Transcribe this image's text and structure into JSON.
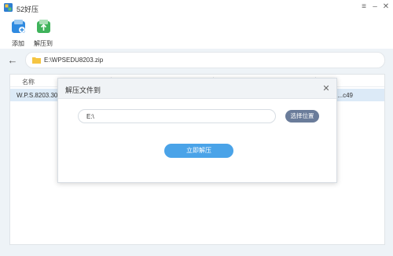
{
  "app": {
    "title": "52好压"
  },
  "toolbar": {
    "add_label": "添加",
    "extract_label": "解压到"
  },
  "path_bar": {
    "path": "E:\\WPSEDU8203.zip"
  },
  "file_list": {
    "columns": [
      "名称"
    ],
    "rows": [
      {
        "name": "W.P.S.8203.30...",
        "extra": "...c49"
      }
    ]
  },
  "dialog": {
    "title": "解压文件到",
    "destination_value": "E:\\",
    "choose_location_label": "选择位置",
    "extract_now_label": "立即解压"
  },
  "colors": {
    "accent": "#4aa3e8",
    "secondary_button": "#6a7c9a",
    "selected_row": "#dceaf7",
    "background": "#eef3f7"
  }
}
